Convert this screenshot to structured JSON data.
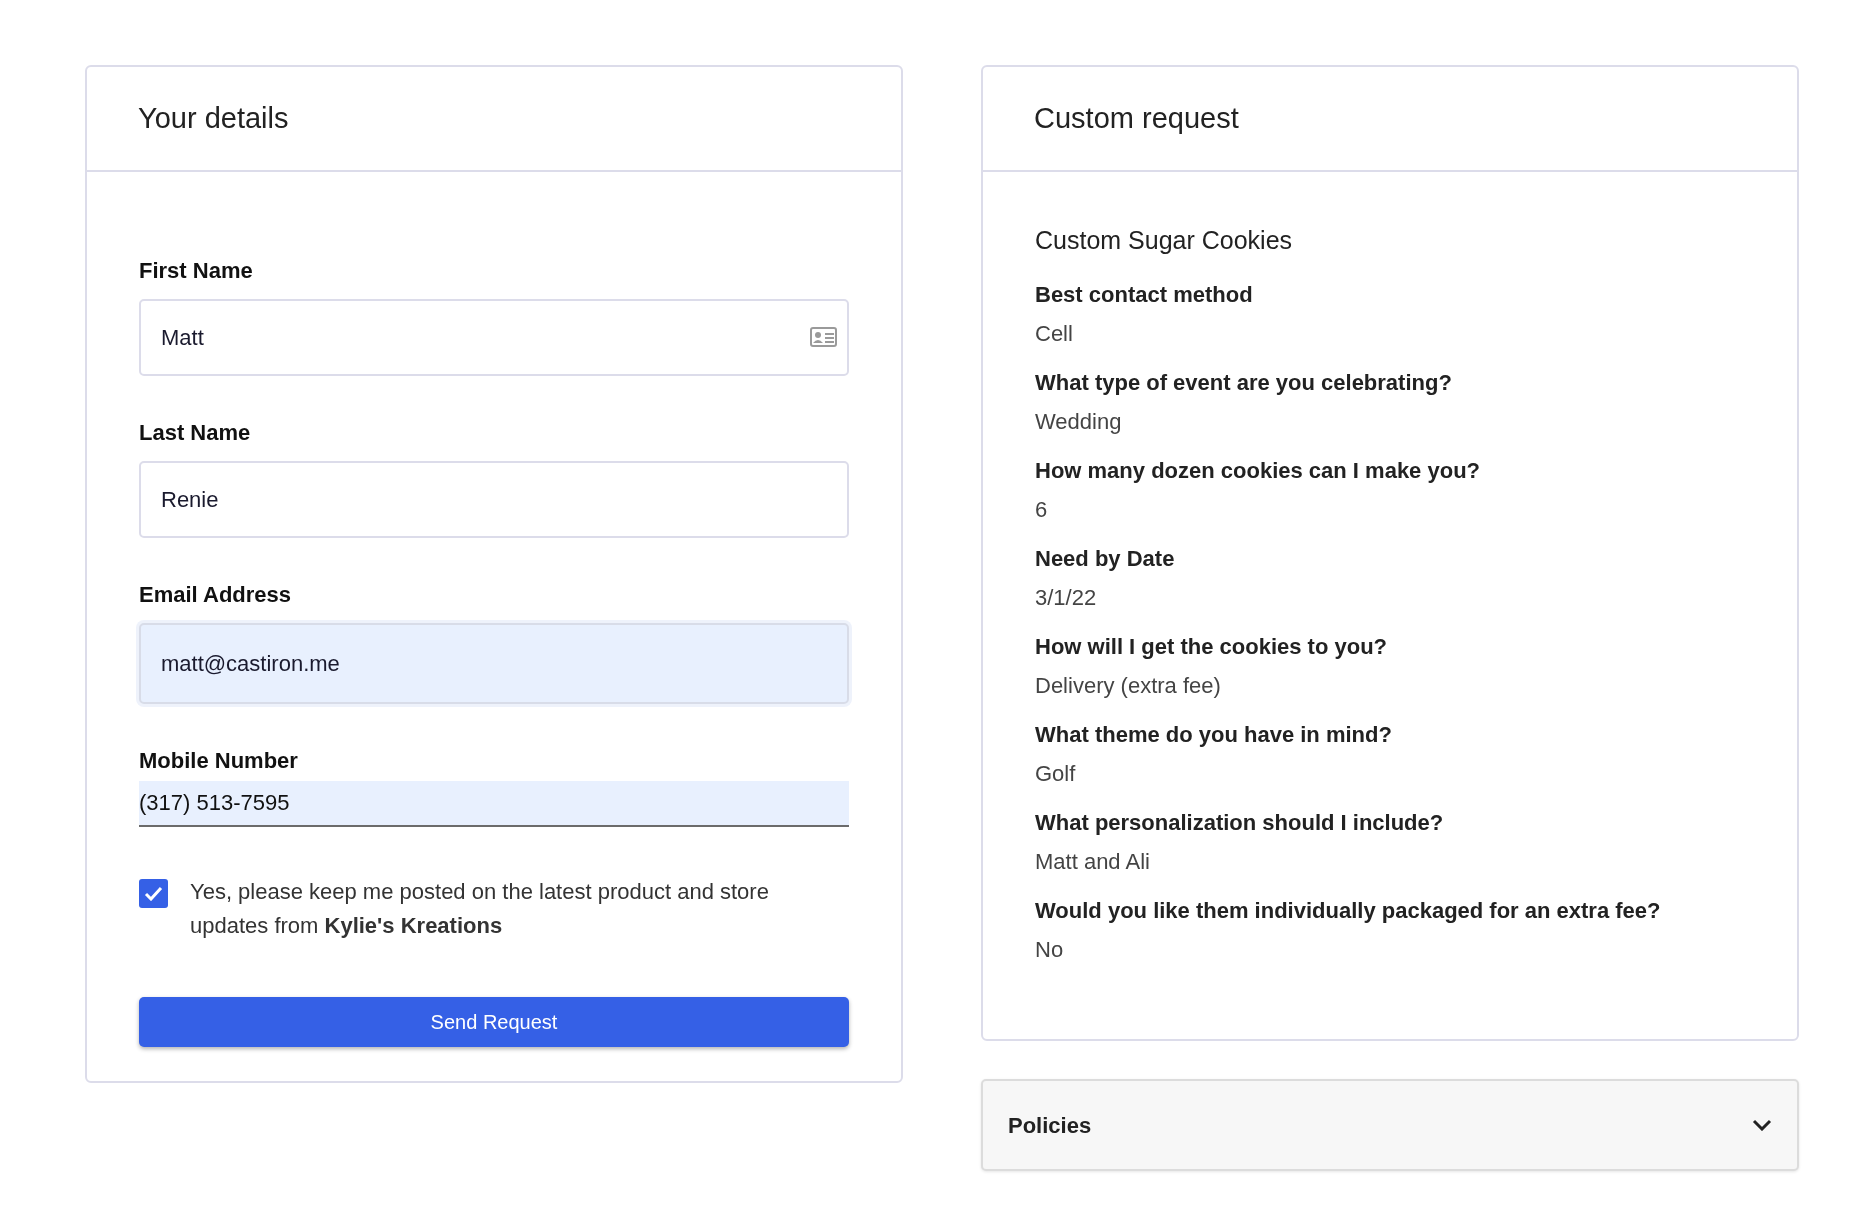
{
  "details": {
    "title": "Your details",
    "fields": [
      {
        "label": "First Name",
        "value": "Matt",
        "kind": "card-icon"
      },
      {
        "label": "Last Name",
        "value": "Renie",
        "kind": "plain"
      },
      {
        "label": "Email Address",
        "value": "matt@castiron.me",
        "kind": "autofill"
      },
      {
        "label": "Mobile Number",
        "value": "(317) 513-7595",
        "kind": "underline"
      }
    ],
    "consent": {
      "checked": true,
      "text": "Yes, please keep me posted on the latest product and store updates from **Kylie's Kreations**"
    },
    "submit": "Send Request"
  },
  "request": {
    "title": "Custom request",
    "product": "Custom Sugar Cookies",
    "answers": [
      {
        "question": "Best contact method",
        "answer": "Cell"
      },
      {
        "question": "What type of event are you celebrating?",
        "answer": "Wedding"
      },
      {
        "question": "How many dozen cookies can I make you?",
        "answer": "6"
      },
      {
        "question": "Need by Date",
        "answer": "3/1/22"
      },
      {
        "question": "How will I get the cookies to you?",
        "answer": "Delivery (extra fee)"
      },
      {
        "question": "What theme do you have in mind?",
        "answer": "Golf"
      },
      {
        "question": "What personalization should I include?",
        "answer": "Matt and Ali"
      },
      {
        "question": "Would you like them individually packaged for an extra fee?",
        "answer": "No"
      }
    ]
  },
  "policies": {
    "title": "Policies",
    "expanded": false
  }
}
